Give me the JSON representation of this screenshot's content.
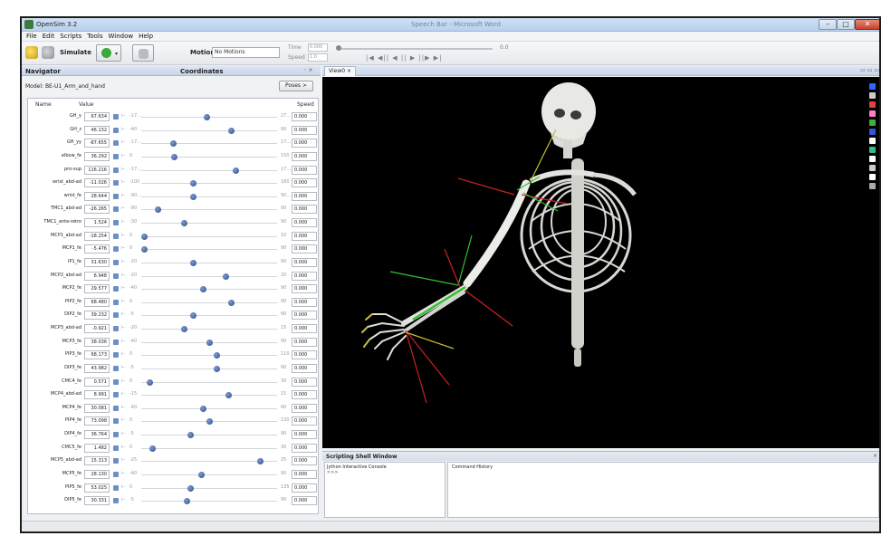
{
  "window": {
    "title": "OpenSim 3.2",
    "center_title": "Speech Bar - Microsoft Word",
    "minimize_label": "–",
    "maximize_label": "□",
    "close_label": "✕"
  },
  "menu": [
    "File",
    "Edit",
    "Scripts",
    "Tools",
    "Window",
    "Help"
  ],
  "toolbar": {
    "simulate_label": "Simulate",
    "simulate_arrow": "▾",
    "motion_label": "Motion:",
    "motion_value": "No Motions",
    "time_label": "Time",
    "time_value": "0.000",
    "speed_label": "Speed",
    "speed_value": "1.0",
    "time_end": "0.0",
    "playback": "|◀ ◀|| ◀ || ▶ ||▶ ▶|"
  },
  "navigator": {
    "tab_label": "Navigator",
    "coordinates_tab_label": "Coordinates",
    "panel_controls": "◦ ×",
    "model_label": "Model: BE-U1_Arm_and_hand",
    "poses_label": "Poses >"
  },
  "coordinates": {
    "col_name": "Name",
    "col_value": "Value",
    "col_speed": "Speed",
    "rows": [
      {
        "name": "GH_y",
        "value": "67.634",
        "min": "-17...",
        "max": "27...",
        "pos": 0.48,
        "speed": "0.000"
      },
      {
        "name": "GH_z",
        "value": "46.132",
        "min": "-40",
        "max": "90",
        "pos": 0.66,
        "speed": "0.000"
      },
      {
        "name": "GH_yy",
        "value": "-87.655",
        "min": "-17...",
        "max": "17...",
        "pos": 0.23,
        "speed": "0.000"
      },
      {
        "name": "elbow_fe",
        "value": "36.292",
        "min": "0",
        "max": "150",
        "pos": 0.24,
        "speed": "0.000"
      },
      {
        "name": "pro-sup",
        "value": "116.216",
        "min": "-17...",
        "max": "17...",
        "pos": 0.69,
        "speed": "0.000"
      },
      {
        "name": "wrist_abd-ad",
        "value": "-11.026",
        "min": "-100",
        "max": "180",
        "pos": 0.38,
        "speed": "0.000"
      },
      {
        "name": "wrist_fe",
        "value": "28.644",
        "min": "-90...",
        "max": "90...",
        "pos": 0.38,
        "speed": "0.000"
      },
      {
        "name": "TMC1_abd-ad",
        "value": "-26.265",
        "min": "-90",
        "max": "90",
        "pos": 0.12,
        "speed": "0.000"
      },
      {
        "name": "TMC1_ante-retro",
        "value": "1.524",
        "min": "-30",
        "max": "90",
        "pos": 0.31,
        "speed": "0.000"
      },
      {
        "name": "MCP1_abd-ad",
        "value": "-18.254",
        "min": "0",
        "max": "10",
        "pos": 0.02,
        "speed": "0.000"
      },
      {
        "name": "MCP1_fe",
        "value": "-5.476",
        "min": "0",
        "max": "90",
        "pos": 0.02,
        "speed": "0.000"
      },
      {
        "name": "IP1_fe",
        "value": "31.630",
        "min": "-20",
        "max": "90",
        "pos": 0.38,
        "speed": "0.000"
      },
      {
        "name": "MCP2_abd-ad",
        "value": "6.948",
        "min": "-20",
        "max": "20",
        "pos": 0.62,
        "speed": "0.000"
      },
      {
        "name": "MCP2_fe",
        "value": "29.577",
        "min": "-40",
        "max": "90",
        "pos": 0.45,
        "speed": "0.000"
      },
      {
        "name": "PIP2_fe",
        "value": "68.480",
        "min": "0",
        "max": "90",
        "pos": 0.66,
        "speed": "0.000"
      },
      {
        "name": "DIP2_fe",
        "value": "39.232",
        "min": "-5",
        "max": "90",
        "pos": 0.38,
        "speed": "0.000"
      },
      {
        "name": "MCP3_abd-ad",
        "value": "-0.921",
        "min": "-20",
        "max": "15",
        "pos": 0.31,
        "speed": "0.000"
      },
      {
        "name": "MCP3_fe",
        "value": "38.036",
        "min": "-40",
        "max": "90",
        "pos": 0.5,
        "speed": "0.000"
      },
      {
        "name": "PIP3_fe",
        "value": "68.173",
        "min": "0",
        "max": "110",
        "pos": 0.55,
        "speed": "0.000"
      },
      {
        "name": "DIP3_fe",
        "value": "43.982",
        "min": "-5",
        "max": "90",
        "pos": 0.55,
        "speed": "0.000"
      },
      {
        "name": "CMC4_fe",
        "value": "0.571",
        "min": "0",
        "max": "30",
        "pos": 0.06,
        "speed": "0.000"
      },
      {
        "name": "MCP4_abd-ad",
        "value": "8.991",
        "min": "-15",
        "max": "15",
        "pos": 0.64,
        "speed": "0.000"
      },
      {
        "name": "MCP4_fe",
        "value": "30.081",
        "min": "-40",
        "max": "90",
        "pos": 0.45,
        "speed": "0.000"
      },
      {
        "name": "PIP4_fe",
        "value": "73.098",
        "min": "0",
        "max": "130",
        "pos": 0.5,
        "speed": "0.000"
      },
      {
        "name": "DIP4_fe",
        "value": "36.764",
        "min": "-5",
        "max": "90",
        "pos": 0.36,
        "speed": "0.000"
      },
      {
        "name": "CMC5_fe",
        "value": "1.482",
        "min": "0",
        "max": "30",
        "pos": 0.08,
        "speed": "0.000"
      },
      {
        "name": "MCP5_abd-ad",
        "value": "15.313",
        "min": "-25",
        "max": "25",
        "pos": 0.87,
        "speed": "0.000"
      },
      {
        "name": "MCP5_fe",
        "value": "28.130",
        "min": "-40",
        "max": "90",
        "pos": 0.44,
        "speed": "0.000"
      },
      {
        "name": "PIP5_fe",
        "value": "53.025",
        "min": "0",
        "max": "135",
        "pos": 0.36,
        "speed": "0.000"
      },
      {
        "name": "DIP5_fe",
        "value": "30.331",
        "min": "-5",
        "max": "90",
        "pos": 0.33,
        "speed": "0.000"
      }
    ]
  },
  "view": {
    "tab_label": "View0",
    "tab_close": "×",
    "controls": "▭ ▭ ▭"
  },
  "view_toolbar_colors": [
    "#3366ff",
    "#cccccc",
    "#e04040",
    "#ff7fbf",
    "#40b040",
    "#3355dd",
    "#ffffff",
    "#33bb88",
    "#ffffff",
    "#cccccc",
    "#ffffff",
    "#aaaaaa"
  ],
  "shell": {
    "title": "Scripting Shell Window",
    "close": "×",
    "console_title": "Jython Interactive Console",
    "prompt": ">>>",
    "history_title": "Command History"
  }
}
